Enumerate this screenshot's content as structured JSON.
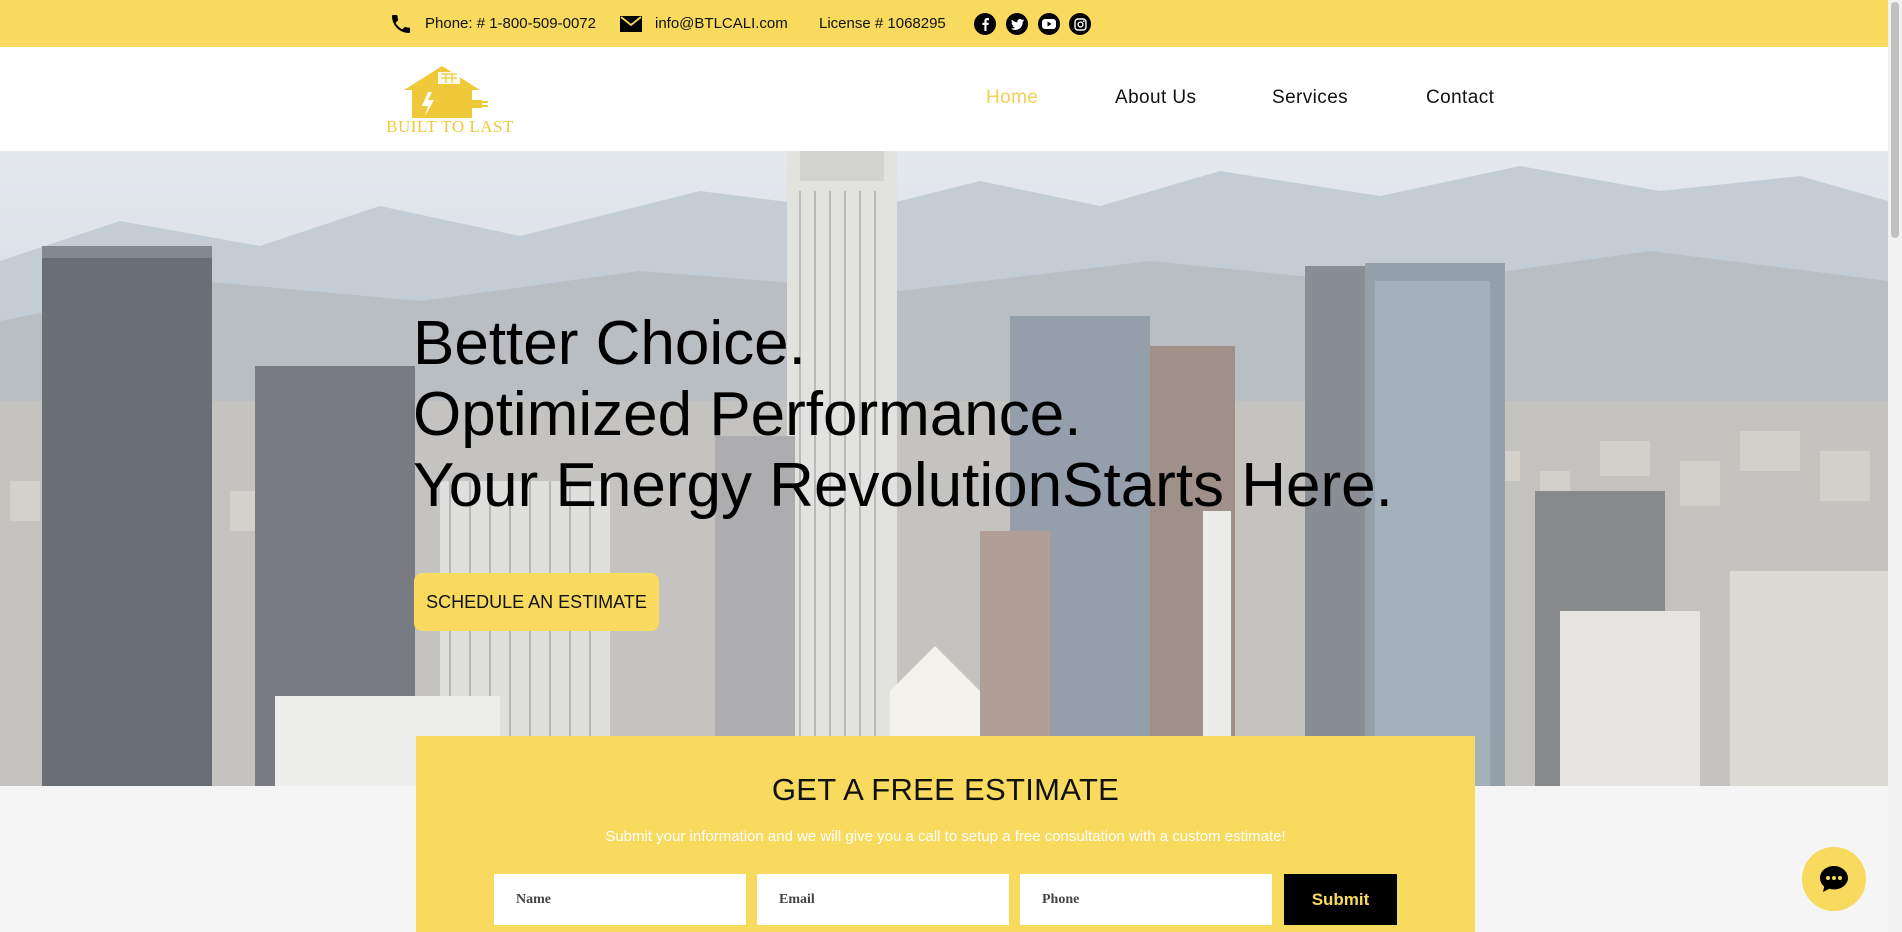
{
  "topbar": {
    "phone_text": "Phone: # 1-800-509-0072",
    "email_text": "info@BTLCALI.com",
    "license_text": "License # 1068295",
    "social": [
      "facebook-icon",
      "twitter-icon",
      "youtube-icon",
      "instagram-icon"
    ]
  },
  "header": {
    "logo_text": "BUILT TO LAST",
    "nav": [
      {
        "label": "Home",
        "active": true
      },
      {
        "label": "About Us",
        "active": false
      },
      {
        "label": "Services",
        "active": false
      },
      {
        "label": "Contact",
        "active": false
      }
    ]
  },
  "hero": {
    "lines": [
      "Better Choice.",
      "Optimized Performance.",
      "Your Energy RevolutionStarts Here."
    ],
    "cta_label": "SCHEDULE AN ESTIMATE"
  },
  "estimate": {
    "title": "GET A FREE ESTIMATE",
    "subtitle": "Submit your information and we will give you a call to setup a free consultation with a custom estimate!",
    "name_placeholder": "Name",
    "email_placeholder": "Email",
    "phone_placeholder": "Phone",
    "submit_label": "Submit"
  },
  "colors": {
    "brand_yellow": "#f7da5e",
    "nav_active": "#f2cf55",
    "submit_bg": "#000000"
  }
}
